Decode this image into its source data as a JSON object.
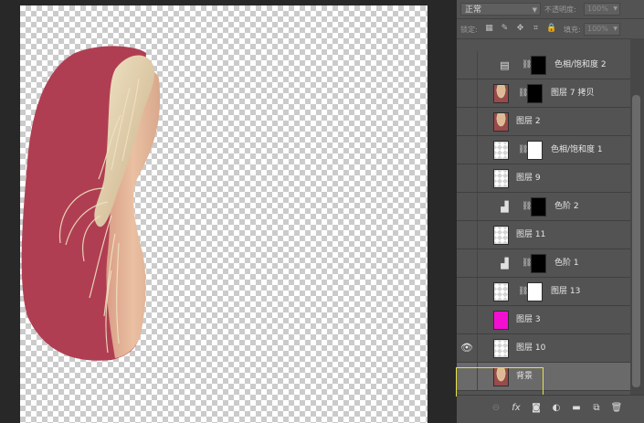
{
  "options": {
    "blend_mode": "正常",
    "opacity_label": "不透明度:",
    "opacity_value": "100%",
    "lock_label": "锁定:",
    "fill_label": "填充:",
    "fill_value": "100%"
  },
  "layers": [
    {
      "name": "色相/饱和度 2",
      "visible": false,
      "type": "adjustment",
      "icon": "hue-saturation-icon",
      "mask": "black-with-white-arc",
      "selected": false
    },
    {
      "name": "图层 7 拷贝",
      "visible": false,
      "type": "pixel",
      "thumb": "portrait",
      "mask": "black-with-white-arc",
      "selected": false
    },
    {
      "name": "图层 2",
      "visible": false,
      "type": "pixel",
      "thumb": "portrait",
      "mask": null,
      "selected": false
    },
    {
      "name": "色相/饱和度 1",
      "visible": false,
      "type": "pixel",
      "thumb": "transparent-sketch",
      "mask": "white",
      "selected": false
    },
    {
      "name": "图层 9",
      "visible": false,
      "type": "pixel",
      "thumb": "transparent-sketch",
      "mask": null,
      "selected": false
    },
    {
      "name": "色阶 2",
      "visible": false,
      "type": "adjustment",
      "icon": "levels-icon",
      "mask": "black-with-white-arc",
      "selected": false
    },
    {
      "name": "图层 11",
      "visible": false,
      "type": "pixel",
      "thumb": "transparent-sketch",
      "mask": null,
      "selected": false
    },
    {
      "name": "色阶 1",
      "visible": false,
      "type": "adjustment",
      "icon": "levels-icon",
      "mask": "black-with-white-dot",
      "selected": false
    },
    {
      "name": "图层 13",
      "visible": false,
      "type": "pixel",
      "thumb": "transparent",
      "mask": "white-with-black-arc",
      "selected": false
    },
    {
      "name": "图层 3",
      "visible": false,
      "type": "pixel",
      "thumb": "magenta",
      "mask": null,
      "selected": false
    },
    {
      "name": "图层 10",
      "visible": true,
      "type": "pixel",
      "thumb": "transparent-sketch",
      "mask": null,
      "selected": false
    },
    {
      "name": "背景",
      "visible": false,
      "type": "pixel",
      "thumb": "portrait",
      "mask": null,
      "selected": true
    }
  ],
  "toolbar": {
    "icons": [
      "link-layers-icon",
      "fx-icon",
      "add-mask-icon",
      "adjustment-layer-icon",
      "group-folder-icon",
      "new-layer-icon",
      "delete-icon"
    ]
  },
  "colors": {
    "canvas_bg": "#282828",
    "panel_bg": "#535353",
    "selected_row": "#6a6a6a",
    "highlight_border": "#e6e24a",
    "silhouette": "#b03e52",
    "magenta_swatch": "#f20fd2"
  }
}
